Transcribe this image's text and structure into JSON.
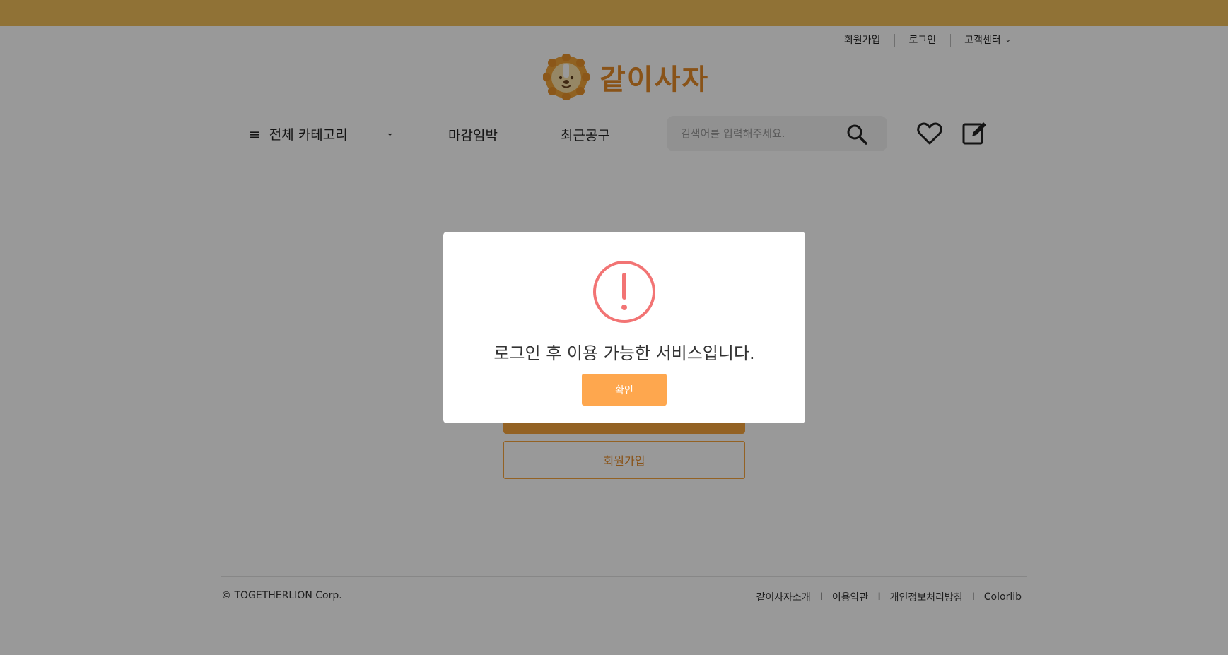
{
  "util_nav": {
    "signup": "회원가입",
    "login": "로그인",
    "customer_center": "고객센터"
  },
  "logo": {
    "text": "같이사자"
  },
  "nav": {
    "all_categories": "전체 카테고리",
    "deadline": "마감임박",
    "recent": "최근공구"
  },
  "search": {
    "placeholder": "검색어를 입력해주세요."
  },
  "page": {
    "signup_button": "회원가입"
  },
  "footer": {
    "copyright": "© TOGETHERLION Corp.",
    "links": [
      "같이사자소개",
      "이용약관",
      "개인정보처리방침",
      "Colorlib"
    ],
    "separator": "I"
  },
  "modal": {
    "message": "로그인 후 이용 가능한 서비스입니다.",
    "confirm": "확인"
  },
  "colors": {
    "topbar": "#f0be5a",
    "accent": "#f5a33c",
    "logo_text": "#e58a28",
    "warning": "#f27474"
  }
}
